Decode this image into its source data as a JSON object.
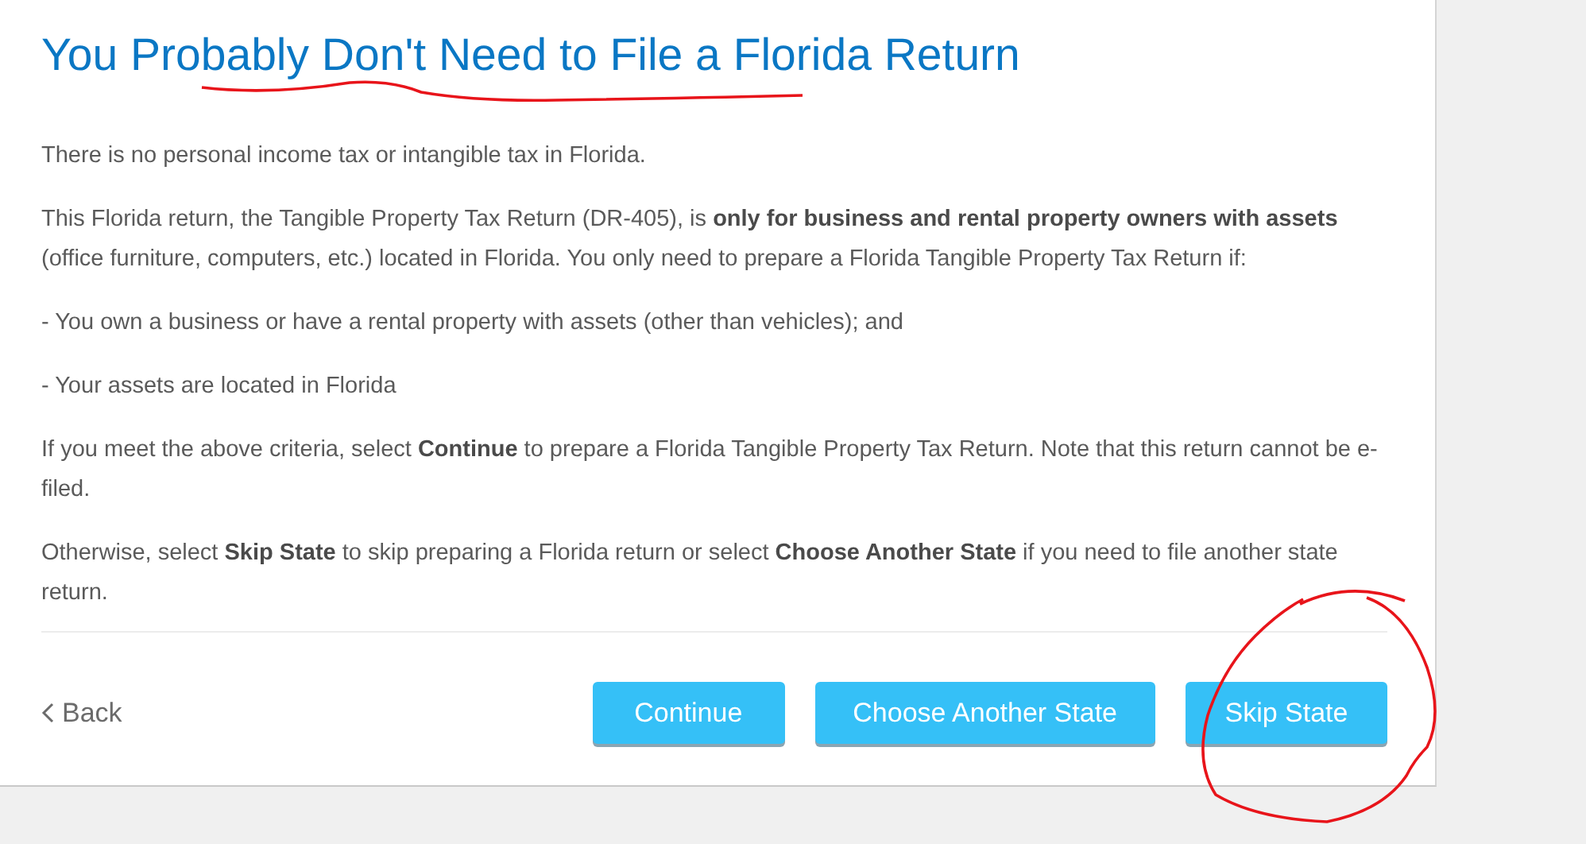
{
  "title": "You Probably Don't Need to File a Florida Return",
  "paragraphs": [
    "There is no personal income tax or intangible tax in Florida.",
    "This Florida return, the Tangible Property Tax Return (DR-405), is **only for business and rental property owners with assets** (office furniture, computers, etc.) located in Florida. You only need to prepare a Florida Tangible Property Tax Return if:",
    "- You own a business or have a rental property with assets (other than vehicles); and",
    "- Your assets are located in Florida",
    "If you meet the above criteria, select **Continue** to prepare a Florida Tangible Property Tax Return. Note that this return cannot be e-filed.",
    "Otherwise, select **Skip State** to skip preparing a Florida return or select **Choose Another State** if you need to file another state return."
  ],
  "back": "Back",
  "buttons": [
    "Continue",
    "Choose Another State",
    "Skip State"
  ]
}
